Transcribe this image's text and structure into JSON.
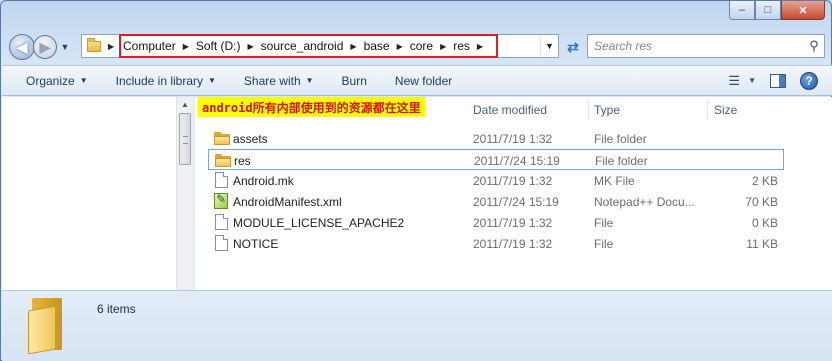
{
  "window": {
    "minimize_glyph": "–",
    "maximize_glyph": "□",
    "close_glyph": "✕"
  },
  "address": {
    "crumbs": [
      "Computer",
      "Soft (D:)",
      "source_android",
      "base",
      "core",
      "res"
    ],
    "highlight_color": "#e21b23"
  },
  "search": {
    "placeholder": "Search res"
  },
  "toolbar": {
    "organize": "Organize",
    "include_in_library": "Include in library",
    "share_with": "Share with",
    "burn": "Burn",
    "new_folder": "New folder"
  },
  "annotation": {
    "text": "android所有内部使用到的资源都在这里",
    "background": "#ffff00",
    "color": "#d4131b"
  },
  "columns": {
    "date_modified": "Date modified",
    "type": "Type",
    "size": "Size"
  },
  "files": [
    {
      "name": "assets",
      "date": "2011/7/19 1:32",
      "type": "File folder",
      "size": "",
      "icon": "folder-icon",
      "selected": false
    },
    {
      "name": "res",
      "date": "2011/7/24 15:19",
      "type": "File folder",
      "size": "",
      "icon": "folder-icon",
      "selected": true
    },
    {
      "name": "Android.mk",
      "date": "2011/7/19 1:32",
      "type": "MK File",
      "size": "2 KB",
      "icon": "file-icon",
      "selected": false
    },
    {
      "name": "AndroidManifest.xml",
      "date": "2011/7/24 15:19",
      "type": "Notepad++ Docu...",
      "size": "70 KB",
      "icon": "xml-file-icon",
      "selected": false
    },
    {
      "name": "MODULE_LICENSE_APACHE2",
      "date": "2011/7/19 1:32",
      "type": "File",
      "size": "0 KB",
      "icon": "file-icon",
      "selected": false
    },
    {
      "name": "NOTICE",
      "date": "2011/7/19 1:32",
      "type": "File",
      "size": "11 KB",
      "icon": "file-icon",
      "selected": false
    }
  ],
  "details": {
    "count_text": "6 items"
  }
}
